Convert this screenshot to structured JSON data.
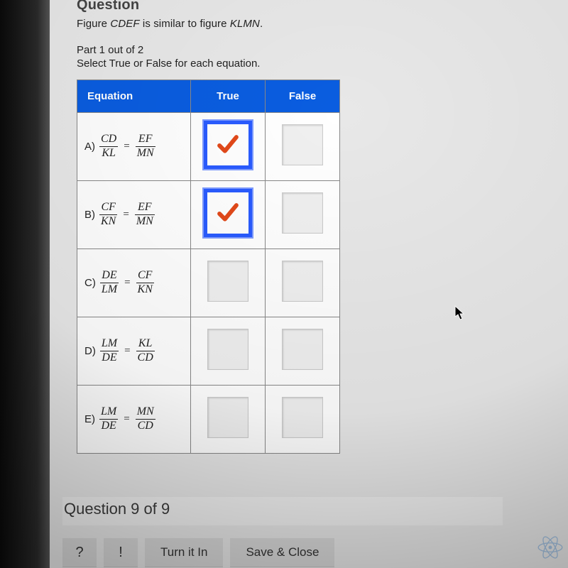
{
  "heading": "Question",
  "prompt_prefix": "Figure ",
  "prompt_fig1": "CDEF",
  "prompt_mid": " is similar to figure ",
  "prompt_fig2": "KLMN",
  "prompt_suffix": ".",
  "part_label": "Part 1 out of 2",
  "instruction": "Select True or False for each equation.",
  "table": {
    "col_equation": "Equation",
    "col_true": "True",
    "col_false": "False"
  },
  "rows": [
    {
      "label": "A)",
      "n1": "CD",
      "d1": "KL",
      "n2": "EF",
      "d2": "MN",
      "true_selected": true,
      "false_selected": false
    },
    {
      "label": "B)",
      "n1": "CF",
      "d1": "KN",
      "n2": "EF",
      "d2": "MN",
      "true_selected": true,
      "false_selected": false
    },
    {
      "label": "C)",
      "n1": "DE",
      "d1": "LM",
      "n2": "CF",
      "d2": "KN",
      "true_selected": false,
      "false_selected": false
    },
    {
      "label": "D)",
      "n1": "LM",
      "d1": "DE",
      "n2": "KL",
      "d2": "CD",
      "true_selected": false,
      "false_selected": false
    },
    {
      "label": "E)",
      "n1": "LM",
      "d1": "DE",
      "n2": "MN",
      "d2": "CD",
      "true_selected": false,
      "false_selected": false
    }
  ],
  "footer": {
    "counter": "Question 9 of 9",
    "help": "?",
    "report": "!",
    "turn_in": "Turn it In",
    "save_close": "Save & Close"
  }
}
